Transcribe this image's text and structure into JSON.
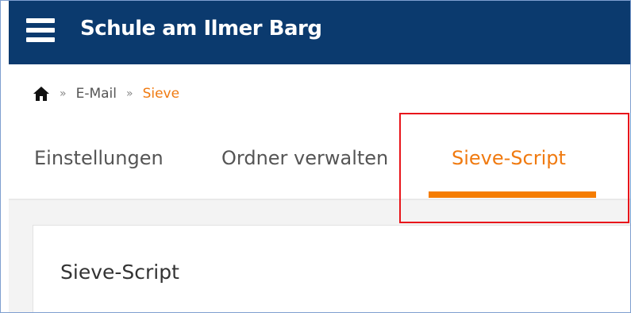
{
  "header": {
    "title": "Schule am Ilmer Barg",
    "menu_icon": "hamburger-menu-icon",
    "background_color": "#0b3a6e"
  },
  "breadcrumb": {
    "home_icon": "home-icon",
    "separator": "»",
    "items": [
      {
        "label": "E-Mail"
      },
      {
        "label": "Sieve",
        "current": true
      }
    ]
  },
  "tabs": [
    {
      "label": "Einstellungen",
      "active": false
    },
    {
      "label": "Ordner verwalten",
      "active": false
    },
    {
      "label": "Sieve-Script",
      "active": true
    }
  ],
  "panel": {
    "title": "Sieve-Script"
  },
  "colors": {
    "accent": "#f57c00",
    "highlight_box": "#e8151b",
    "text": "#555555"
  }
}
